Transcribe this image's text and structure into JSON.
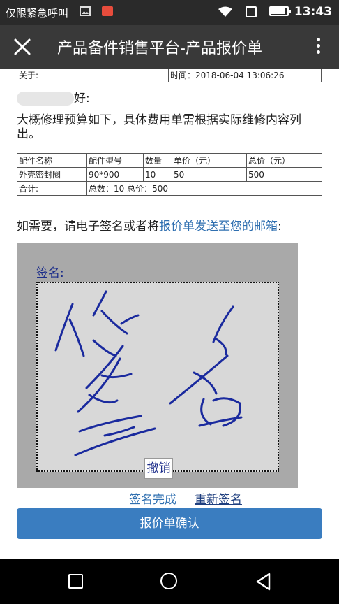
{
  "status_bar": {
    "carrier_text": "仅限紧急呼叫",
    "time": "13:43",
    "icons": [
      "image-icon",
      "app-notification-icon",
      "wifi-icon",
      "sim-icon",
      "battery-icon"
    ]
  },
  "app_bar": {
    "title": "产品备件销售平台-产品报价单",
    "icons": [
      "close-icon",
      "more-vert-icon"
    ]
  },
  "info": {
    "about_label": "关于:",
    "time_text": "时间：2018-06-04 13:06:26"
  },
  "greeting": {
    "suffix": "好:"
  },
  "intro_text": "大概修理预算如下，具体费用单需根据实际维修内容列出。",
  "parts_table": {
    "headers": [
      "配件名称",
      "配件型号",
      "数量",
      "单价（元）",
      "总价（元）"
    ],
    "rows": [
      [
        "外壳密封圈",
        "90*900",
        "10",
        "50",
        "500"
      ]
    ],
    "total_label": "合计:",
    "total_text": "总数：10 总价：500"
  },
  "prompt": {
    "text": "如需要，请电子签名或者将",
    "link_text": "报价单发送至您的邮箱",
    "suffix": ":"
  },
  "signature": {
    "label": "签名:",
    "undo_label": "撤销",
    "done_label": "签名完成",
    "redo_label": "重新签名",
    "ink_color": "#1a2a9e"
  },
  "confirm_label": "报价单确认",
  "colors": {
    "primary_button": "#3a7dc0",
    "link": "#2f6fb0",
    "app_bar": "#393939",
    "status_bar": "#2a2a2a"
  },
  "nav_bar": {
    "icons": [
      "recent-apps-icon",
      "home-icon",
      "back-icon"
    ]
  }
}
